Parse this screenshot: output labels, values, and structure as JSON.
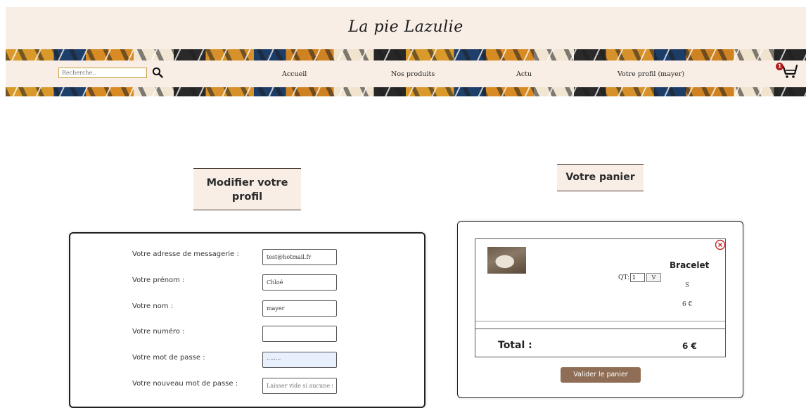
{
  "header": {
    "logo": "La pie Lazulie",
    "search": {
      "placeholder": "Recherche.."
    },
    "nav": [
      "Accueil",
      "Nos produits",
      "Actu",
      "Votre profil (mayer)"
    ],
    "cart_count": "1"
  },
  "profile": {
    "title": "Modifier votre profil",
    "fields": [
      {
        "label": "Votre adresse de messagerie :",
        "value": "test@hotmail.fr",
        "placeholder": ""
      },
      {
        "label": "Votre prénom :",
        "value": "Chloé",
        "placeholder": ""
      },
      {
        "label": "Votre nom :",
        "value": "mayer",
        "placeholder": ""
      },
      {
        "label": "Votre numéro :",
        "value": "",
        "placeholder": ""
      },
      {
        "label": "Votre mot de passe :",
        "value": "········",
        "placeholder": ""
      },
      {
        "label": "Votre nouveau mot de passe :",
        "value": "",
        "placeholder": "Laisser vide si aucune mod"
      }
    ]
  },
  "cart": {
    "title": "Votre panier",
    "item": {
      "name": "Bracelet",
      "qty_label": "QT:",
      "qty_value": "1",
      "qty_button": "V",
      "size": "S",
      "price": "6 €"
    },
    "total_label": "Total :",
    "total_value": "6 €",
    "validate_label": "Valider le panier"
  },
  "colors": {
    "header_bg": "#f8eee6",
    "button_brown": "#8f6e55",
    "badge_red": "#b01e1e"
  }
}
